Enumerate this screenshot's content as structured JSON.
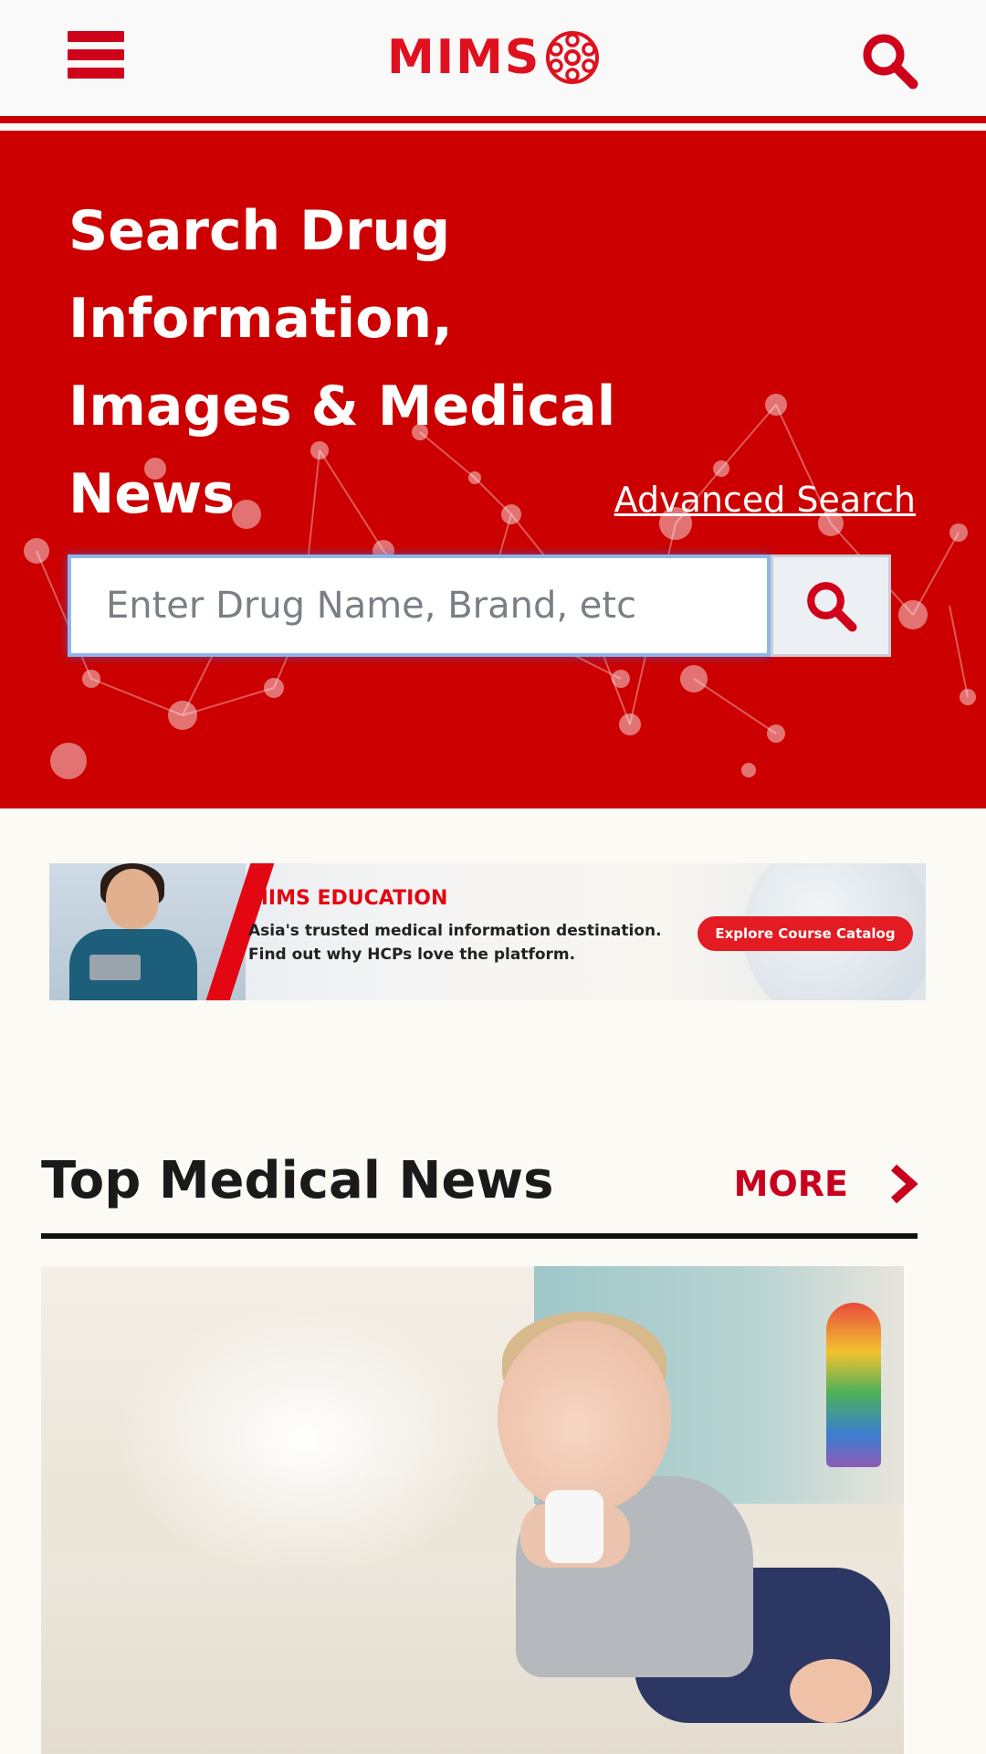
{
  "header": {
    "menu_icon": "hamburger-menu-icon",
    "logo_text": "MIMS",
    "logo_icon": "mims-globe-logo",
    "search_icon": "search-icon"
  },
  "hero": {
    "title": "Search Drug Information, Images & Medical News",
    "advanced_search_label": "Advanced Search",
    "search_placeholder": "Enter Drug Name, Brand, etc",
    "search_value": "",
    "search_button_icon": "search-icon",
    "background_color": "#cc0000"
  },
  "banner": {
    "brand": "MIMS EDUCATION",
    "line1": "Asia's trusted medical information destination.",
    "line2": "Find out why HCPs love the platform.",
    "cta_label": "Explore Course Catalog",
    "accent_color": "#e30613"
  },
  "news": {
    "section_title": "Top Medical News",
    "more_label": "MORE",
    "more_icon": "chevron-right-icon"
  },
  "colors": {
    "brand_red": "#d0021b",
    "page_background": "#fcfaf5"
  }
}
